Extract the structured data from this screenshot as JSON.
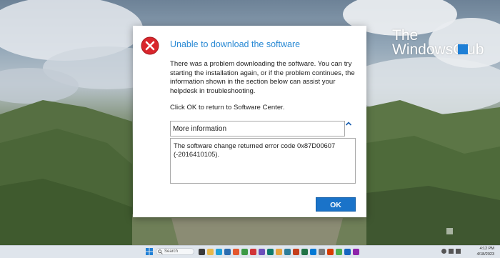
{
  "watermark": {
    "line1": "The",
    "line2": "WindowsClub"
  },
  "dialog": {
    "title": "Unable to download the software",
    "message": "There was a problem downloading the software.  You can try starting the installation again, or if the problem continues, the information shown in the section below can assist your helpdesk in troubleshooting.",
    "instruction": "Click OK to return to Software Center.",
    "more_info_label": "More information",
    "details": "The software change returned error code 0x87D00607 (-2016410105).",
    "ok_label": "OK"
  },
  "taskbar": {
    "search_label": "Search",
    "clock_time": "4:12 PM",
    "clock_date": "4/18/2023"
  },
  "colors": {
    "title_blue": "#2a8ad4",
    "ok_button": "#1a73c9",
    "error_red": "#d9262c"
  },
  "icons": [
    "error-icon",
    "chevron-up-icon",
    "windows-start-icon",
    "search-icon"
  ]
}
